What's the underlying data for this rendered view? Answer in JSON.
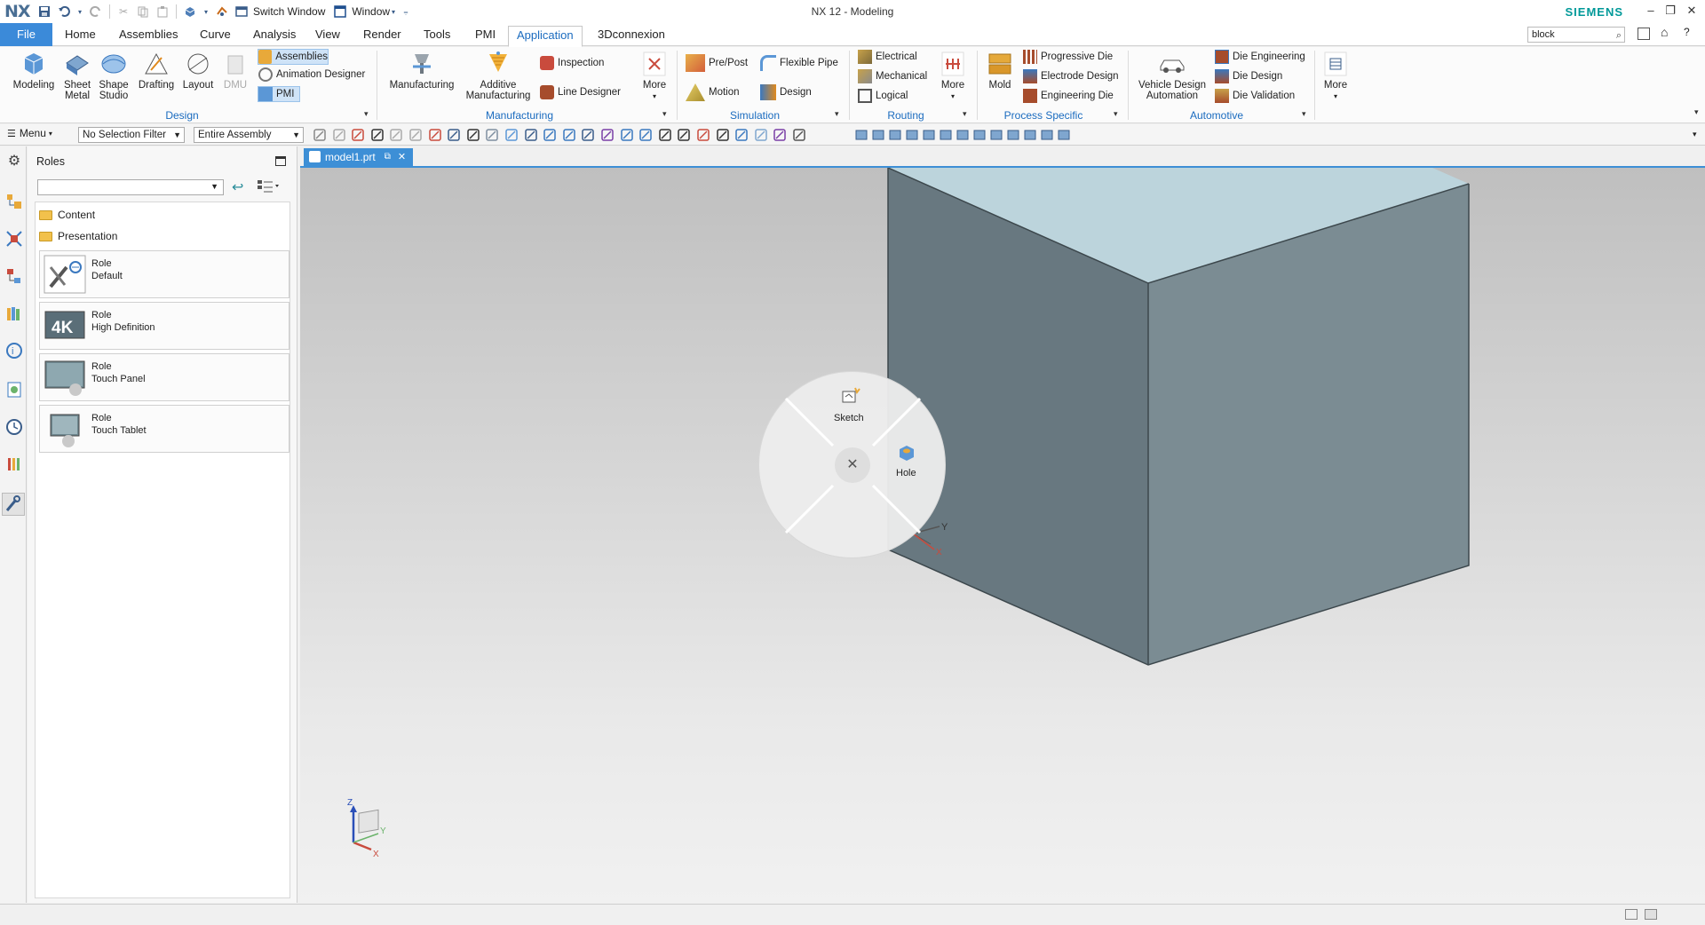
{
  "window": {
    "logo": "NX",
    "title": "NX 12 - Modeling",
    "brand": "SIEMENS",
    "switch_window": "Switch Window",
    "window_menu": "Window"
  },
  "tabs": [
    "File",
    "Home",
    "Assemblies",
    "Curve",
    "Analysis",
    "View",
    "Render",
    "Tools",
    "PMI",
    "Application",
    "3Dconnexion"
  ],
  "active_tab": "Application",
  "search": {
    "value": "block"
  },
  "ribbon": {
    "design": {
      "label": "Design",
      "modeling": "Modeling",
      "sheet_metal_1": "Sheet",
      "sheet_metal_2": "Metal",
      "shape_studio_1": "Shape",
      "shape_studio_2": "Studio",
      "drafting": "Drafting",
      "layout": "Layout",
      "dmu": "DMU",
      "assemblies": "Assemblies",
      "animation_designer": "Animation Designer",
      "pmi": "PMI"
    },
    "manufacturing": {
      "label": "Manufacturing",
      "manufacturing": "Manufacturing",
      "additive_1": "Additive",
      "additive_2": "Manufacturing",
      "inspection": "Inspection",
      "line_designer": "Line Designer",
      "more": "More"
    },
    "simulation": {
      "label": "Simulation",
      "pre_post": "Pre/Post",
      "flexible_pipe": "Flexible Pipe",
      "motion": "Motion",
      "design": "Design"
    },
    "routing": {
      "label": "Routing",
      "electrical": "Electrical",
      "mechanical": "Mechanical",
      "logical": "Logical",
      "more": "More"
    },
    "process_specific": {
      "label": "Process Specific",
      "mold": "Mold",
      "progressive_die": "Progressive Die",
      "electrode_design": "Electrode Design",
      "engineering_die": "Engineering Die"
    },
    "automotive": {
      "label": "Automotive",
      "vehicle_1": "Vehicle Design",
      "vehicle_2": "Automation",
      "die_engineering": "Die Engineering",
      "die_design": "Die Design",
      "die_validation": "Die Validation"
    },
    "more": "More"
  },
  "toolbar": {
    "menu": "Menu",
    "selection_filter": "No Selection Filter",
    "scope": "Entire Assembly"
  },
  "roles_panel": {
    "title": "Roles",
    "folders": [
      "Content",
      "Presentation"
    ],
    "roles": [
      {
        "line1": "Role",
        "line2": "Default"
      },
      {
        "line1": "Role",
        "line2": "High Definition"
      },
      {
        "line1": "Role",
        "line2": "Touch Panel"
      },
      {
        "line1": "Role",
        "line2": "Touch Tablet"
      }
    ]
  },
  "document": {
    "tab": "model1.prt"
  },
  "radial_menu": {
    "sketch": "Sketch",
    "hole": "Hole"
  },
  "colors": {
    "accent": "#3b8ad9",
    "brand": "#009999",
    "block_side": "#6b7a80",
    "block_top": "#bcd4dc"
  }
}
